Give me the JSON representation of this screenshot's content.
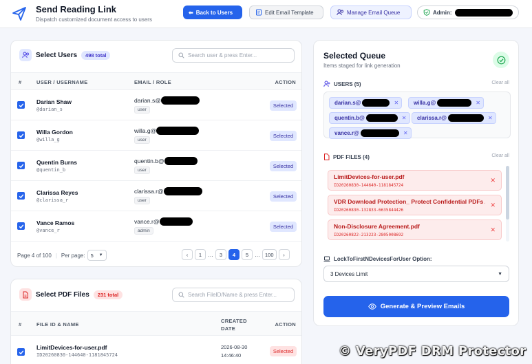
{
  "header": {
    "title": "Send Reading Link",
    "subtitle": "Dispatch customized document access to users",
    "back_btn": "Back to Users",
    "edit_template_btn": "Edit Email Template",
    "manage_queue_btn": "Manage Email Queue",
    "admin_label": "Admin:"
  },
  "users": {
    "title": "Select Users",
    "total": "498 total",
    "search_placeholder": "Search user & press Enter...",
    "columns": [
      "#",
      "USER / USERNAME",
      "EMAIL / ROLE",
      "ACTION"
    ],
    "rows": [
      {
        "name": "Darian Shaw",
        "handle": "@darian_s",
        "email": "darian.s@",
        "role": "user",
        "action": "Selected"
      },
      {
        "name": "Willa Gordon",
        "handle": "@willa_g",
        "email": "willa.g@",
        "role": "user",
        "action": "Selected"
      },
      {
        "name": "Quentin Burns",
        "handle": "@quentin_b",
        "email": "quentin.b@",
        "role": "user",
        "action": "Selected"
      },
      {
        "name": "Clarissa Reyes",
        "handle": "@clarissa_r",
        "email": "clarissa.r@",
        "role": "user",
        "action": "Selected"
      },
      {
        "name": "Vance Ramos",
        "handle": "@vance_r",
        "email": "vance.r@",
        "role": "admin",
        "action": "Selected"
      }
    ],
    "page_info": "Page 4 of 100",
    "per_page_label": "Per page:",
    "per_page_value": "5",
    "pages": [
      "‹",
      "1",
      "…",
      "3",
      "4",
      "5",
      "…",
      "100",
      "›"
    ]
  },
  "pdfs": {
    "title": "Select PDF Files",
    "total": "231 total",
    "search_placeholder": "Search FileID/Name & press Enter...",
    "columns": [
      "#",
      "FILE ID & NAME",
      "CREATED DATE",
      "ACTION"
    ],
    "rows": [
      {
        "name": "LimitDevices-for-user.pdf",
        "id": "ID20260830-144640-1181845724",
        "date": "2026-08-30",
        "time": "14:46:40",
        "action": "Selected"
      }
    ]
  },
  "queue": {
    "title": "Selected Queue",
    "subtitle": "Items staged for link generation",
    "users_label": "USERS (5)",
    "clear_all": "Clear all",
    "chips": [
      "darian.s@",
      "willa.g@",
      "quentin.b@",
      "clarissa.r@",
      "vance.r@"
    ],
    "pdf_label": "PDF FILES (4)",
    "files": [
      {
        "name": "LimitDevices-for-user.pdf",
        "id": "ID20260830-144640-1181845724"
      },
      {
        "name": "VDR Download Protection_ Protect Confidential PDFs Af...",
        "id": "ID20260830-132833-6635844426"
      },
      {
        "name": "Non-Disclosure Agreement.pdf",
        "id": "ID20260822-213223-2805008692"
      }
    ],
    "option_label": "LockToFirstNDevicesForUser Option:",
    "option_value": "3 Devices Limit",
    "generate_btn": "Generate & Preview Emails"
  },
  "watermark": "© VeryPDF DRM Protector",
  "colors": {
    "accent": "#2563eb",
    "danger": "#ef4444",
    "success": "#16a34a"
  }
}
